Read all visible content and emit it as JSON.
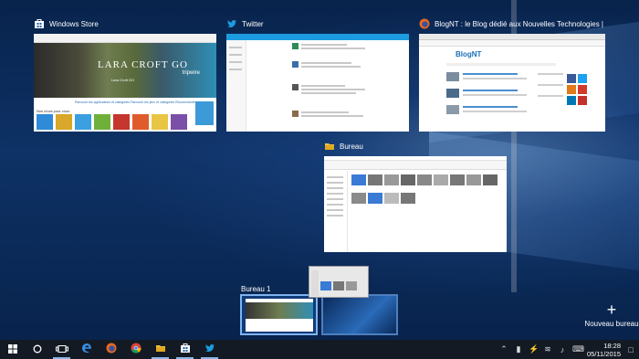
{
  "thumbnails": [
    {
      "title": "Windows Store"
    },
    {
      "title": "Twitter"
    },
    {
      "title": "BlogNT : le Blog dédié aux Nouvelles Technologies | actu..."
    },
    {
      "title": "Bureau"
    }
  ],
  "store_preview": {
    "hero_title": "LARA CROFT GO",
    "hero_sub": "Lara Croft GO",
    "hero_right": "tripwire",
    "links": "Parcourir les applications et catégories   Parcourir les jeux et catégories   Recommandés",
    "section": "Nos choix pour vous"
  },
  "blog_preview": {
    "logo": "BlogNT"
  },
  "virtual_desktops": {
    "desktops": [
      {
        "label": "Bureau 1"
      }
    ],
    "new_desktop_label": "Nouveau bureau"
  },
  "taskbar": {
    "items": [
      "start-button",
      "cortana-search-button",
      "task-view-button",
      "edge-button",
      "firefox-button",
      "chrome-button",
      "file-explorer-button",
      "store-button",
      "twitter-button"
    ],
    "clock_time": "18:28",
    "clock_date": "05/11/2015"
  },
  "colors": {
    "accent": "#1d9be0",
    "taskbar": "#131a24",
    "desktop_blue": "#113b78",
    "active_desktop_border": "#7fb3f0"
  }
}
